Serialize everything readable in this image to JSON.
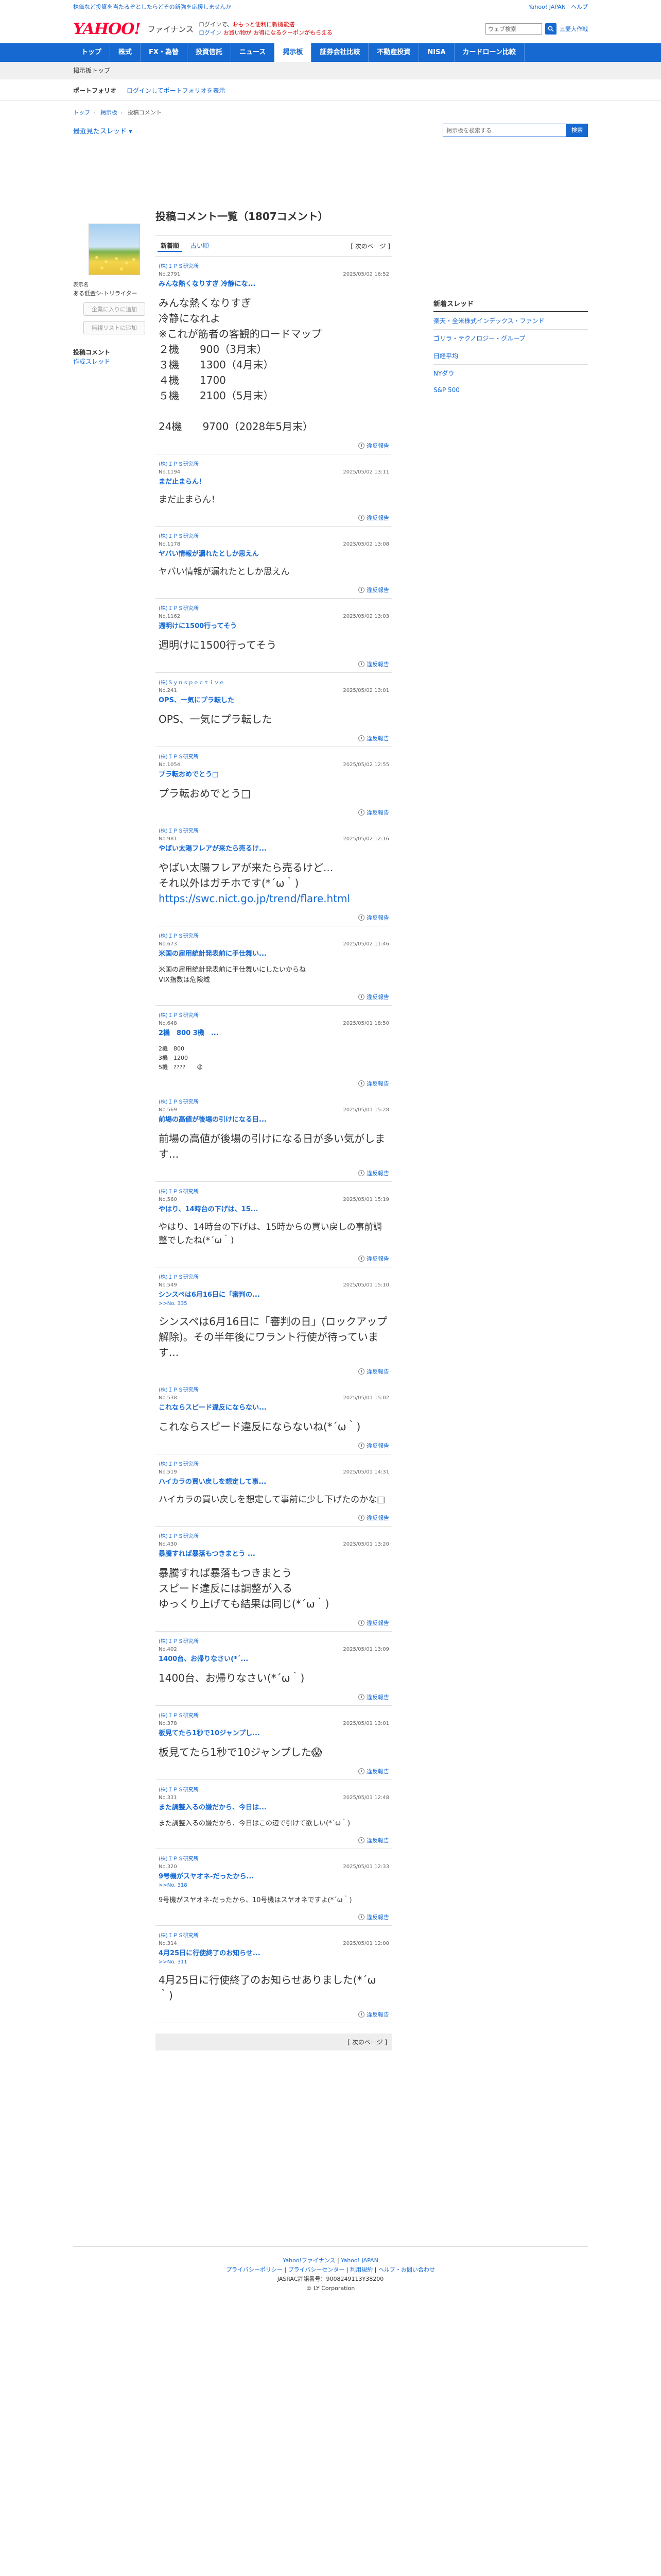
{
  "announce": {
    "text": "株価など投資を当たるぞとしたらどその新強を応援しませんか",
    "links": [
      "Yahoo! JAPAN",
      "ヘルプ"
    ],
    "search_placeholder": "ウェブ検索",
    "search_btn": "",
    "mypage": "三菱大作戦"
  },
  "header": {
    "logo": "YAHOO!",
    "logo_sub": "ファイナンス",
    "promo_line1": "ログインで、",
    "promo_red1": "おもっと便利に新機能搭",
    "promo_line2": "ログイン",
    "promo_red2": "お買い物が お得になるクーポンがもらえる"
  },
  "nav": {
    "items": [
      "トップ",
      "株式",
      "FX・為替",
      "投資信託",
      "ニュース",
      "掲示板",
      "証券会社比較",
      "不動産投資",
      "NISA",
      "カードローン比較"
    ],
    "active_index": 5
  },
  "subnav": {
    "label": "掲示板トップ"
  },
  "portfolio_bar": {
    "title": "ポートフォリオ",
    "login_link": "ログインしてポートフォリオを表示"
  },
  "breadcrumb": [
    "トップ",
    "掲示板",
    "投稿コメント"
  ],
  "thread_link": "最近見たスレッド",
  "board_search": {
    "placeholder": "掲示板を検索する",
    "button": "検索"
  },
  "sidebar_left": {
    "profile_label": "表示名",
    "profile_name": "ある低金シ‐トリライター",
    "btn_follow": "企業に入りに追加",
    "btn_block": "無視リストに追加",
    "menu": [
      "投稿コメント",
      "作成スレッド"
    ]
  },
  "main": {
    "title": "投稿コメント一覧（1807コメント）",
    "tabs": [
      "新着順",
      "古い順"
    ],
    "pager": "[ 次のページ ]",
    "report_label": "違反報告",
    "bottom_pager": "[ 次のページ ]",
    "posts": [
      {
        "author": "(株)ＩＰＳ研究所",
        "no": "No.2791",
        "date": "2025/05/02 16:52",
        "title": "みんな熱くなりすぎ 冷静にな...",
        "reply": "",
        "body": "みんな熱くなりすぎ\n冷静になれよ\n※これが筋者の客観的ロードマップ\n２機　　900（3月末）\n３機　　1300（4月末）\n４機　　1700\n５機　　2100（5月末）\n\n24機　　9700（2028年5月末）",
        "size": "size-l"
      },
      {
        "author": "(株)ＩＰＳ研究所",
        "no": "No.1194",
        "date": "2025/05/02 13:11",
        "title": "まだ止まらん！",
        "reply": "",
        "body": "まだ止まらん！",
        "size": "size-m"
      },
      {
        "author": "(株)ＩＰＳ研究所",
        "no": "No.1178",
        "date": "2025/05/02 13:08",
        "title": "ヤバい情報が漏れたとしか思えん",
        "reply": "",
        "body": "ヤバい情報が漏れたとしか思えん",
        "size": "size-m"
      },
      {
        "author": "(株)ＩＰＳ研究所",
        "no": "No.1162",
        "date": "2025/05/02 13:03",
        "title": "週明けに1500行ってそう",
        "reply": "",
        "body": "週明けに1500行ってそう",
        "size": "size-l"
      },
      {
        "author": "(株)Ｓｙｎｓｐｅｃｔｉｖｅ",
        "no": "No.241",
        "date": "2025/05/02 13:01",
        "title": "OPS、一気にプラ転した",
        "reply": "",
        "body": "OPS、一気にプラ転した",
        "size": "size-l"
      },
      {
        "author": "(株)ＩＰＳ研究所",
        "no": "No.1054",
        "date": "2025/05/02 12:55",
        "title": "プラ転おめでとう□",
        "reply": "",
        "body": "プラ転おめでとう□",
        "size": "size-l"
      },
      {
        "author": "(株)ＩＰＳ研究所",
        "no": "No.981",
        "date": "2025/05/02 12:16",
        "title": "やばい太陽フレアが来たら売るけ...",
        "reply": "",
        "body": "やばい太陽フレアが来たら売るけど...\nそれ以外はガチホです(*´ω｀)",
        "url": "https://swc.nict.go.jp/trend/flare.html",
        "size": "size-l"
      },
      {
        "author": "(株)ＩＰＳ研究所",
        "no": "No.673",
        "date": "2025/05/02 11:46",
        "title": "米国の雇用統計発表前に手仕舞い...",
        "reply": "",
        "body": "米国の雇用統計発表前に手仕舞いにしたいからね\nVIX指数は危険域",
        "size": "size-s"
      },
      {
        "author": "(株)ＩＰＳ研究所",
        "no": "No.648",
        "date": "2025/05/01 18:50",
        "title": "2機　800 3機　...",
        "reply": "",
        "body": "2機　800\n3機　1200\n5機　????　　😩",
        "size": "size-xs"
      },
      {
        "author": "(株)ＩＰＳ研究所",
        "no": "No.569",
        "date": "2025/05/01 15:28",
        "title": "前場の高値が後場の引けになる日...",
        "reply": "",
        "body": "前場の高値が後場の引けになる日が多い気がします...",
        "size": "size-l"
      },
      {
        "author": "(株)ＩＰＳ研究所",
        "no": "No.560",
        "date": "2025/05/01 15:19",
        "title": "やはり、14時台の下げは、15...",
        "reply": "",
        "body": "やはり、14時台の下げは、15時からの買い戻しの事前調整でしたね(*´ω｀)",
        "size": "size-m"
      },
      {
        "author": "(株)ＩＰＳ研究所",
        "no": "No.549",
        "date": "2025/05/01 15:10",
        "title": "シンスペは6月16日に「審判の...",
        "reply": ">>No. 335",
        "body": "シンスペは6月16日に「審判の日」(ロックアップ解除)。その半年後にワラント行使が待っています...",
        "size": "size-l"
      },
      {
        "author": "(株)ＩＰＳ研究所",
        "no": "No.538",
        "date": "2025/05/01 15:02",
        "title": "これならスピード違反にならない...",
        "reply": "",
        "body": "これならスピード違反にならないね(*´ω｀)",
        "size": "size-l"
      },
      {
        "author": "(株)ＩＰＳ研究所",
        "no": "No.519",
        "date": "2025/05/01 14:31",
        "title": "ハイカラの買い戻しを想定して事...",
        "reply": "",
        "body": "ハイカラの買い戻しを想定して事前に少し下げたのかな□",
        "size": "size-m"
      },
      {
        "author": "(株)ＩＰＳ研究所",
        "no": "No.430",
        "date": "2025/05/01 13:20",
        "title": "暴騰すれば暴落もつきまとう ...",
        "reply": "",
        "body": "暴騰すれば暴落もつきまとう\nスピード違反には調整が入る\nゆっくり上げても結果は同じ(*´ω｀)",
        "size": "size-l"
      },
      {
        "author": "(株)ＩＰＳ研究所",
        "no": "No.402",
        "date": "2025/05/01 13:09",
        "title": "1400台、お帰りなさい(*´...",
        "reply": "",
        "body": "1400台、お帰りなさい(*´ω｀)",
        "size": "size-l"
      },
      {
        "author": "(株)ＩＰＳ研究所",
        "no": "No.378",
        "date": "2025/05/01 13:01",
        "title": "板見てたら1秒で10ジャンプし...",
        "reply": "",
        "body": "板見てたら1秒で10ジャンプした😱",
        "size": "size-l"
      },
      {
        "author": "(株)ＩＰＳ研究所",
        "no": "No.331",
        "date": "2025/05/01 12:48",
        "title": "また調整入るの嫌だから、今日は...",
        "reply": "",
        "body": "また調整入るの嫌だから、今日はこの辺で引けて欲しい(*´ω｀)",
        "size": "size-s"
      },
      {
        "author": "(株)ＩＰＳ研究所",
        "no": "No.320",
        "date": "2025/05/01 12:33",
        "title": "9号機がスヤオネ-だったから...",
        "reply": ">>No. 318",
        "body": "9号機がスヤオネ-だったから、10号機はスヤオネですよ(*´ω｀)",
        "size": "size-s"
      },
      {
        "author": "(株)ＩＰＳ研究所",
        "no": "No.314",
        "date": "2025/05/01 12:00",
        "title": "4月25日に行使終了のお知らせ...",
        "reply": ">>No. 311",
        "body": "4月25日に行使終了のお知らせありました(*´ω｀)",
        "size": "size-l"
      }
    ]
  },
  "sidebar_right": {
    "title": "新着スレッド",
    "items": [
      "楽天・全米株式インデックス・ファンド",
      "ゴリラ・テクノロジー・グループ",
      "日経平均",
      "NYダウ",
      "S&P 500"
    ]
  },
  "footer": {
    "line1": [
      "Yahoo!ファイナンス",
      "Yahoo! JAPAN"
    ],
    "line2": [
      "プライバシーポリシー",
      "プライバシーセンター",
      "利用規約",
      "ヘルプ・お問い合わせ"
    ],
    "line3": "JASRAC許諾番号：9008249113Y38200",
    "copyright": "© LY Corporation"
  },
  "colors": {
    "accent": "#1769d2",
    "brand_red": "#ff0033"
  }
}
